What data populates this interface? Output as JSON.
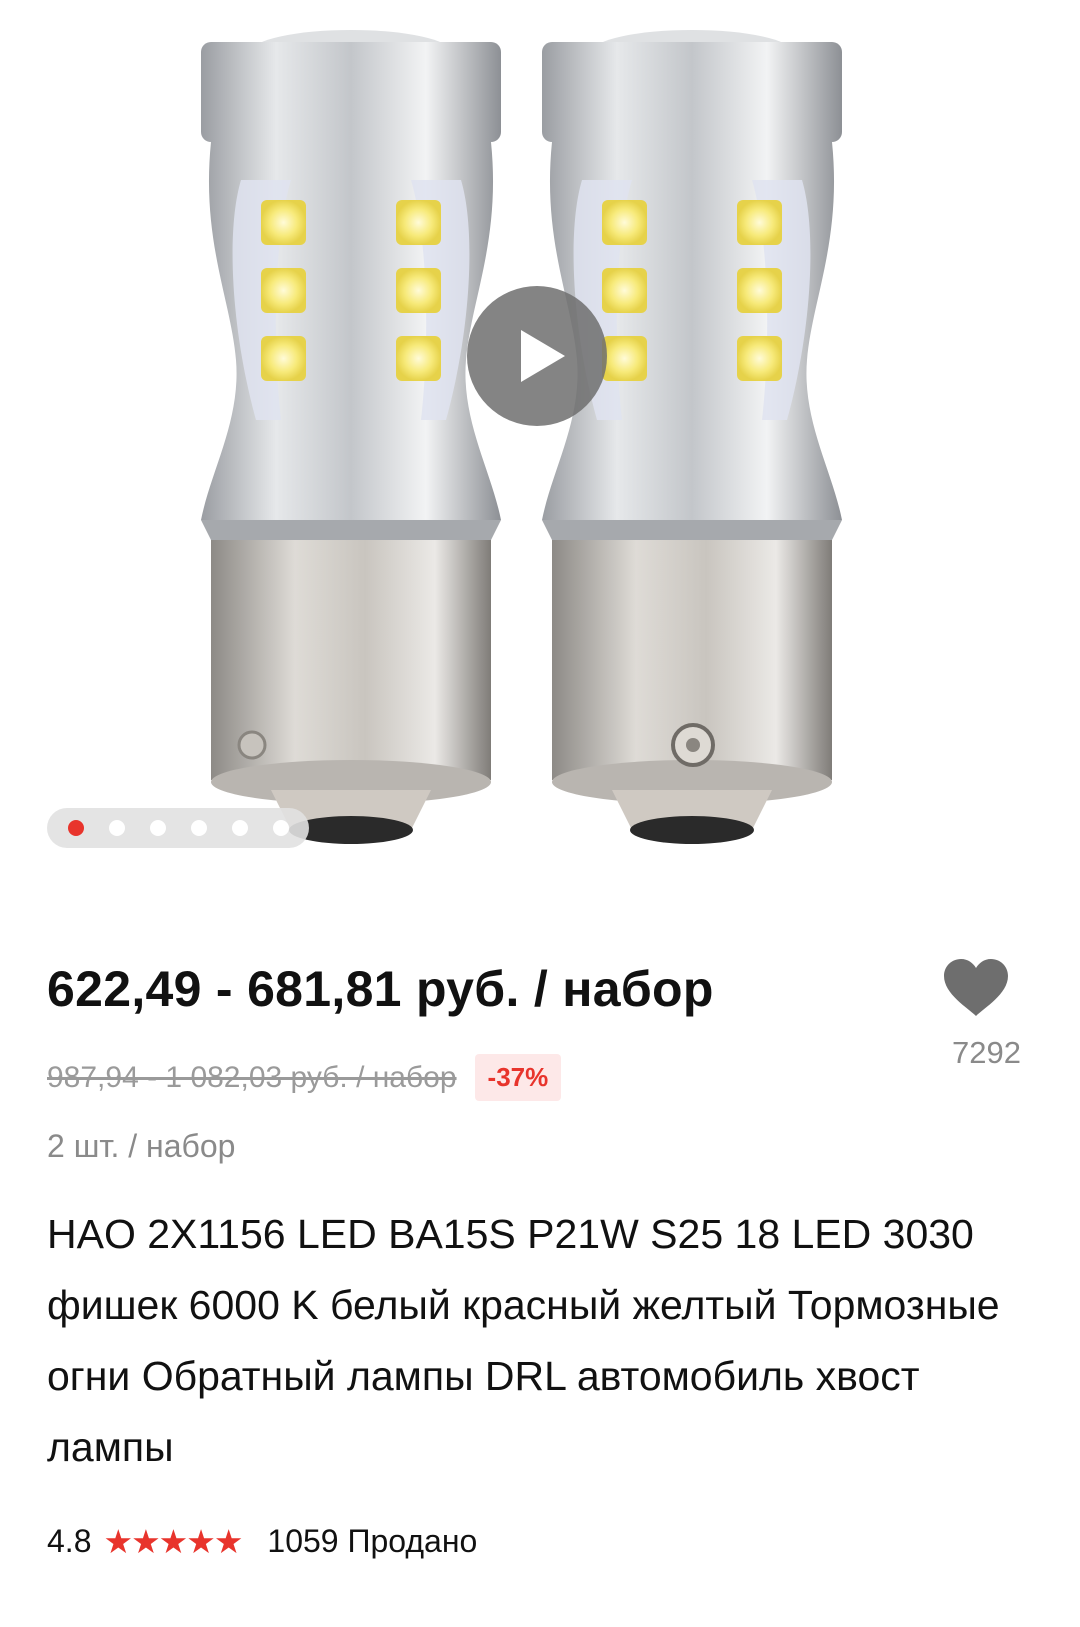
{
  "gallery": {
    "image_alt": "LED bulb product photo",
    "play_label": "play-video",
    "dots": [
      true,
      false,
      false,
      false,
      false,
      false
    ]
  },
  "product": {
    "price": "622,49 - 681,81 руб. / набор",
    "old_price": "987,94 - 1 082,03 руб. / набор",
    "discount": "-37%",
    "favorites_count": "7292",
    "quantity": "2 шт. / набор",
    "title": "HAO 2X1156 LED BA15S P21W S25 18 LED 3030 фишек 6000 K белый красный желтый Тормозные огни Обратный лампы DRL автомобиль хвост лампы",
    "rating": "4.8",
    "stars": "★★★★★",
    "sold": "1059 Продано"
  },
  "colors": {
    "accent": "#e8342c",
    "muted": "#8a8a8a"
  }
}
